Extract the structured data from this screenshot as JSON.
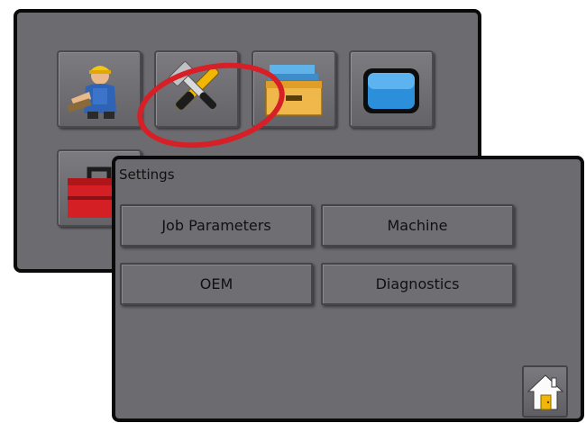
{
  "home_menu": {
    "tiles": [
      {
        "icon": "operator-icon"
      },
      {
        "icon": "tools-icon",
        "highlighted": true
      },
      {
        "icon": "file-drawer-icon"
      },
      {
        "icon": "display-screen-icon"
      },
      {
        "icon": "toolbox-icon"
      }
    ],
    "highlight_color": "#d61f26"
  },
  "settings": {
    "title": "Settings",
    "buttons": {
      "job_parameters": "Job Parameters",
      "machine": "Machine",
      "oem": "OEM",
      "diagnostics": "Diagnostics"
    },
    "home_icon": "home-icon"
  },
  "colors": {
    "panel_bg": "#6c6b70",
    "panel_border": "#0a0a0a",
    "button_bg": "#6f6e73"
  }
}
